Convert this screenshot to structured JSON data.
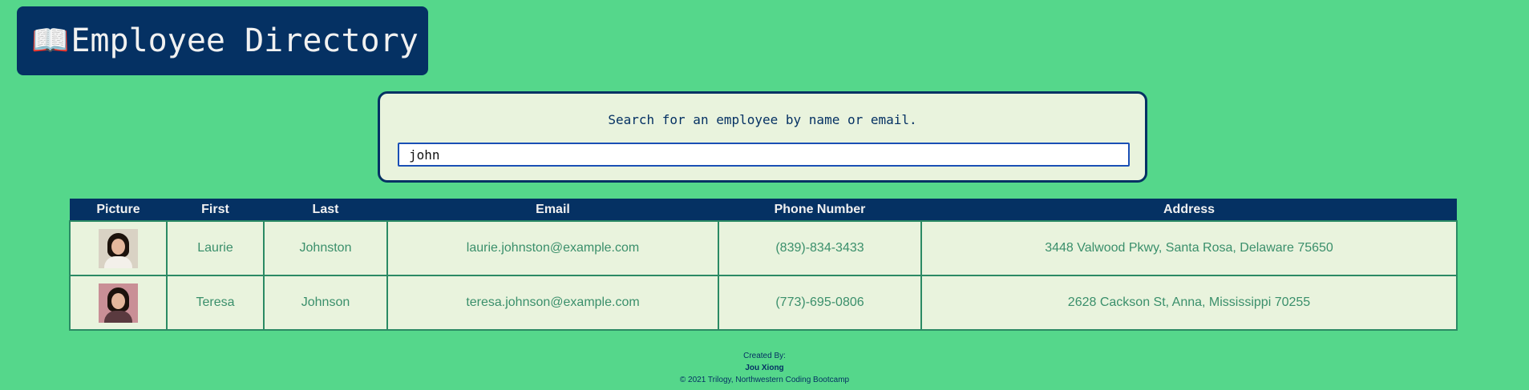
{
  "header": {
    "icon": "open-book-icon",
    "title": "Employee Directory"
  },
  "search": {
    "prompt": "Search for an employee by name or email.",
    "value": "john"
  },
  "table": {
    "columns": [
      "Picture",
      "First",
      "Last",
      "Email",
      "Phone Number",
      "Address"
    ],
    "rows": [
      {
        "picture": "portrait-woman-light-background",
        "first": "Laurie",
        "last": "Johnston",
        "email": "laurie.johnston@example.com",
        "phone": "(839)-834-3433",
        "address": "3448 Valwood Pkwy, Santa Rosa, Delaware 75650"
      },
      {
        "picture": "portrait-woman-pink-background",
        "first": "Teresa",
        "last": "Johnson",
        "email": "teresa.johnson@example.com",
        "phone": "(773)-695-0806",
        "address": "2628 Cackson St, Anna, Mississippi 70255"
      }
    ]
  },
  "footer": {
    "created_by": "Created By:",
    "author": "Jou Xiong",
    "copyright": "© 2021 Trilogy, Northwestern Coding Bootcamp"
  },
  "colors": {
    "page_background": "#55d78b",
    "navy": "#053163",
    "panel": "#e9f3dd",
    "cell_text": "#3a8f6b"
  }
}
